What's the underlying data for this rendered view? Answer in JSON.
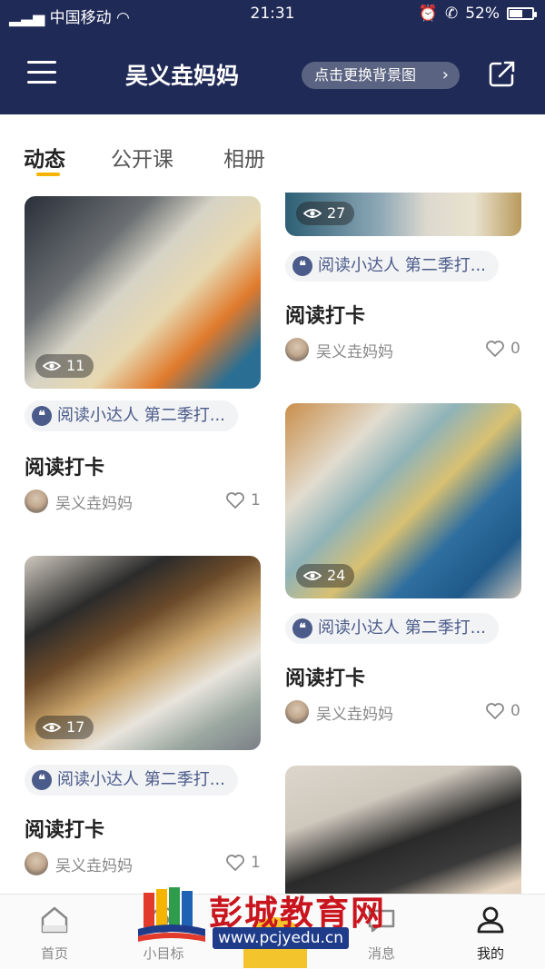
{
  "status": {
    "carrier": "中国移动",
    "time": "21:31",
    "battery": "52%"
  },
  "header": {
    "title": "吴义垚妈妈",
    "bg_button": "点击更换背景图"
  },
  "tabs": [
    {
      "label": "动态"
    },
    {
      "label": "公开课"
    },
    {
      "label": "相册"
    }
  ],
  "feed": {
    "left": [
      {
        "views": "11",
        "tag": "阅读小达人 第二季打...",
        "title": "阅读打卡",
        "author": "吴义垚妈妈",
        "likes": "1"
      },
      {
        "views": "17",
        "tag": "阅读小达人 第二季打...",
        "title": "阅读打卡",
        "author": "吴义垚妈妈",
        "likes": "1"
      }
    ],
    "right": [
      {
        "views": "27",
        "tag": "阅读小达人 第二季打...",
        "title": "阅读打卡",
        "author": "吴义垚妈妈",
        "likes": "0"
      },
      {
        "views": "24",
        "tag": "阅读小达人 第二季打...",
        "title": "阅读打卡",
        "author": "吴义垚妈妈",
        "likes": "0"
      }
    ]
  },
  "tabbar": [
    {
      "label": "首页"
    },
    {
      "label": "小目标"
    },
    {
      "label": ""
    },
    {
      "label": "消息"
    },
    {
      "label": "我的"
    }
  ],
  "watermark": {
    "text": "彭城教育网",
    "url": "www.pcjyedu.cn"
  },
  "colors": {
    "header_bg": "#1f2a57",
    "accent": "#f5b400",
    "tag_text": "#4b5b8a"
  }
}
